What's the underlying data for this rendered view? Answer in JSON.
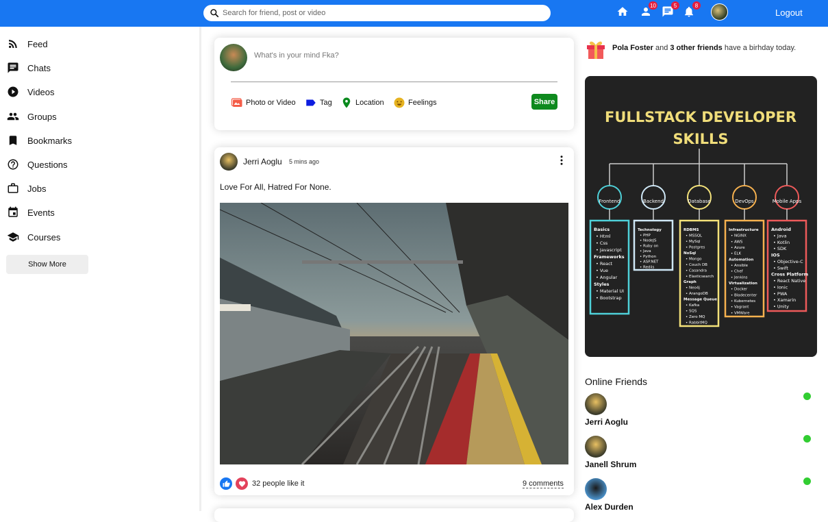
{
  "topbar": {
    "search_placeholder": "Search for friend, post or video",
    "friends_badge": "10",
    "messages_badge": "5",
    "notifications_badge": "8",
    "logout": "Logout",
    "bg_color": "#1877f2"
  },
  "sidebar": {
    "items": [
      {
        "label": "Feed",
        "icon": "rss-feed-icon"
      },
      {
        "label": "Chats",
        "icon": "chat-icon"
      },
      {
        "label": "Videos",
        "icon": "play-circle-icon"
      },
      {
        "label": "Groups",
        "icon": "group-icon"
      },
      {
        "label": "Bookmarks",
        "icon": "bookmark-icon"
      },
      {
        "label": "Questions",
        "icon": "help-circle-icon"
      },
      {
        "label": "Jobs",
        "icon": "work-icon"
      },
      {
        "label": "Events",
        "icon": "event-icon"
      },
      {
        "label": "Courses",
        "icon": "school-icon"
      }
    ],
    "show_more": "Show More"
  },
  "share": {
    "placeholder": "What's in your mind Fka?",
    "options": {
      "photo": "Photo or Video",
      "tag": "Tag",
      "location": "Location",
      "feelings": "Feelings"
    },
    "share_button": "Share"
  },
  "post": {
    "username": "Jerri Aoglu",
    "date": "5 mins ago",
    "text": "Love For All, Hatred For None.",
    "likes": "32 people like it",
    "comments": "9 comments"
  },
  "rightbar": {
    "birthday": {
      "name": "Pola Foster",
      "connector": " and ",
      "others": "3 other friends",
      "suffix": " have a birhday today."
    },
    "ad": {
      "title_line1": "FULLSTACK DEVELOPER",
      "title_line2": "SKILLS",
      "columns": [
        {
          "label": "Frontend",
          "color": "#4fd1d9",
          "lines": [
            "Basics",
            "• Html",
            "• Css",
            "• Javascript",
            "Frameworks",
            "• React",
            "• Vue",
            "• Angular",
            "Styles",
            "• Material UI",
            "• Bootstrap"
          ]
        },
        {
          "label": "Backend",
          "color": "#cfe8f7",
          "lines": [
            "Technology",
            "• PHP",
            "• NodeJS",
            "• Ruby on",
            "• Java",
            "• Python",
            "• ASP.NET",
            "• Rediis"
          ]
        },
        {
          "label": "Database",
          "color": "#f4e27a",
          "lines": [
            "RDBMS",
            "• MSSQL",
            "• MySql",
            "• Postgres",
            "NoSql",
            "• Mongo",
            "• Couch DB",
            "• Casandra",
            "• Elasticsearch",
            "Graph",
            "• Neo4j",
            "• ArangoDB",
            "Message Queue",
            "• Kafka",
            "• SQS",
            "• Zero MQ",
            "• RabbitMQ"
          ]
        },
        {
          "label": "DevOps",
          "color": "#f6b14f",
          "lines": [
            "Infrastructure",
            "• NGINX",
            "• AWS",
            "• Azure",
            "• ELK",
            "Automation",
            "• Ansible",
            "• Chef",
            "• Jenkins",
            "Virtualization",
            "• Docker",
            "• Bladecenter",
            "• Kubernetes",
            "• Vagrant",
            "• VMWare"
          ]
        },
        {
          "label": "Mobile Apps",
          "color": "#ee5a5a",
          "lines": [
            "Android",
            "• Java",
            "• Kotlin",
            "• SDK",
            "IOS",
            "• Objective-C",
            "• Swift",
            "Cross Platform",
            "• React Native",
            "• Ionic",
            "• PWA",
            "• Xamarin",
            "• Unity"
          ]
        }
      ]
    },
    "online_title": "Online Friends",
    "friends": [
      {
        "name": "Jerri Aoglu"
      },
      {
        "name": "Janell Shrum"
      },
      {
        "name": "Alex Durden"
      }
    ]
  }
}
